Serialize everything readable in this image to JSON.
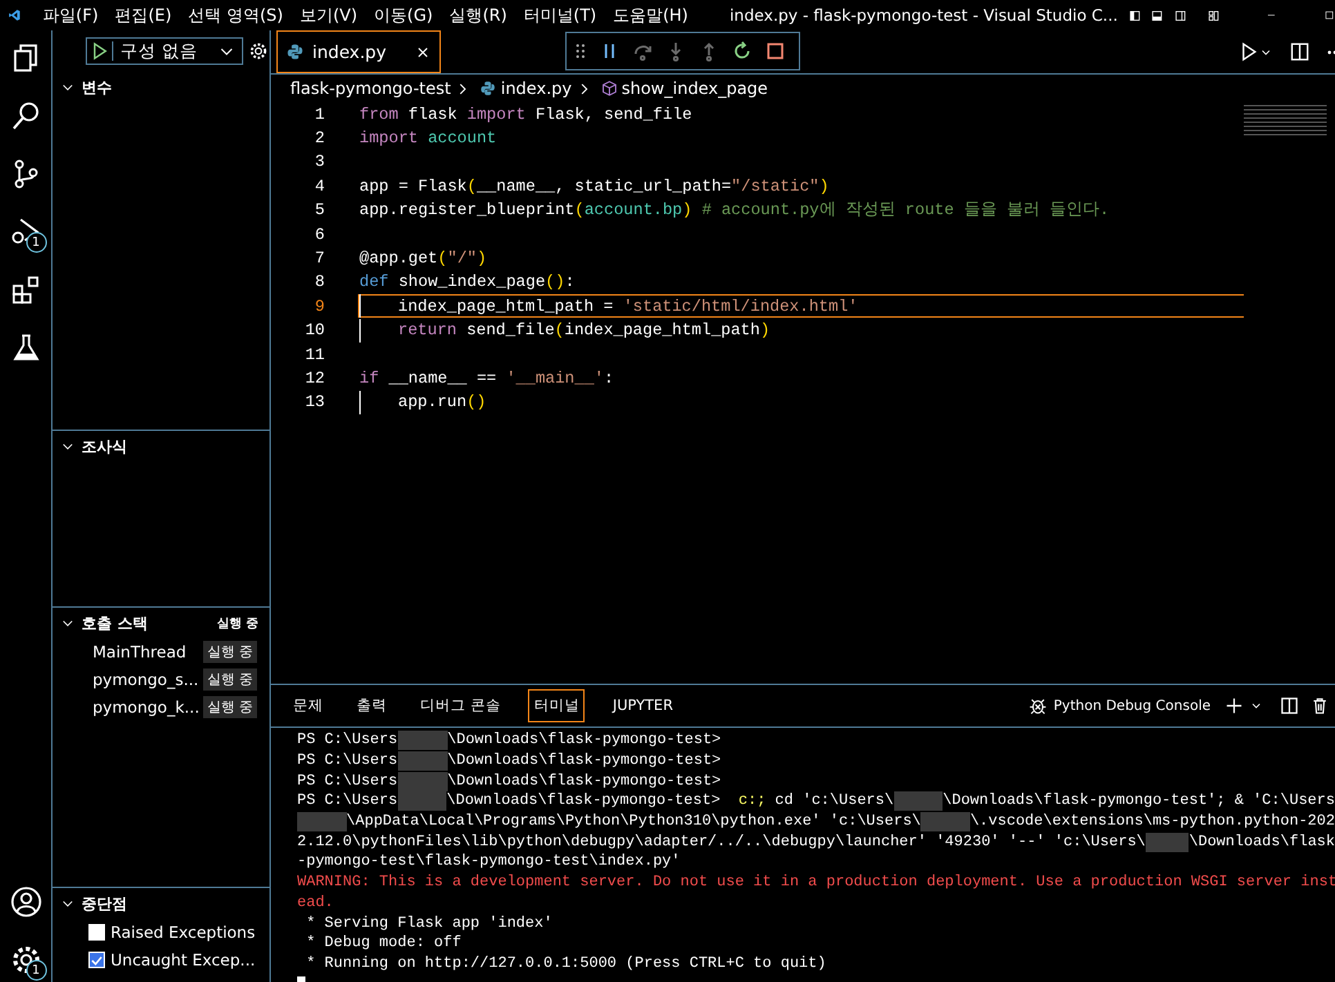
{
  "title_bar": {
    "menus": [
      "파일(F)",
      "편집(E)",
      "선택 영역(S)",
      "보기(V)",
      "이동(G)",
      "실행(R)",
      "터미널(T)",
      "도움말(H)"
    ],
    "title": "index.py - flask-pymongo-test - Visual Studio C..."
  },
  "activity_bar": {
    "debug_badge": "1",
    "settings_badge": "1"
  },
  "sidebar": {
    "run_config": "구성 없음",
    "sections": [
      {
        "kind": "variables",
        "title": "변수",
        "expanded": true
      },
      {
        "kind": "watch",
        "title": "조사식",
        "expanded": true
      },
      {
        "kind": "call_stack",
        "title": "호출 스택",
        "status": "실행 중",
        "expanded": true,
        "threads": [
          {
            "name": "MainThread",
            "status": "실행 중"
          },
          {
            "name": "pymongo_s...",
            "status": "실행 중"
          },
          {
            "name": "pymongo_k...",
            "status": "실행 중"
          }
        ]
      },
      {
        "kind": "breakpoints",
        "title": "중단점",
        "expanded": true,
        "items": [
          {
            "label": "Raised Exceptions",
            "checked": false
          },
          {
            "label": "Uncaught Excep...",
            "checked": true
          }
        ]
      }
    ]
  },
  "debug_toolbar": [
    {
      "kind": "pause",
      "disabled": false
    },
    {
      "kind": "step-over",
      "disabled": true
    },
    {
      "kind": "step-into",
      "disabled": true
    },
    {
      "kind": "step-out",
      "disabled": true
    },
    {
      "kind": "restart",
      "disabled": false
    },
    {
      "kind": "stop",
      "disabled": false
    }
  ],
  "editor": {
    "tabs": [
      {
        "label": "index.py",
        "selected": true
      }
    ],
    "breadcrumbs": [
      "flask-pymongo-test",
      "index.py",
      "show_index_page"
    ],
    "lines": [
      {
        "number": "1",
        "current": false,
        "indent": false,
        "tokens": [
          {
            "kind": "kw",
            "text": "from"
          },
          {
            "kind": "plain",
            "text": " flask "
          },
          {
            "kind": "kw",
            "text": "import"
          },
          {
            "kind": "plain",
            "text": " Flask, send_file"
          }
        ]
      },
      {
        "number": "2",
        "current": false,
        "indent": false,
        "tokens": [
          {
            "kind": "kw",
            "text": "import"
          },
          {
            "kind": "mod",
            "text": " account"
          }
        ]
      },
      {
        "number": "3",
        "current": false,
        "indent": false
      },
      {
        "number": "4",
        "current": false,
        "indent": false,
        "tokens": [
          {
            "kind": "plain",
            "text": "app = Flask"
          },
          {
            "kind": "paren",
            "text": "("
          },
          {
            "kind": "plain",
            "text": "__name__, static_url_path="
          },
          {
            "kind": "str",
            "text": "\"/static\""
          },
          {
            "kind": "paren",
            "text": ")"
          }
        ]
      },
      {
        "number": "5",
        "current": false,
        "indent": false,
        "tokens": [
          {
            "kind": "plain",
            "text": "app.register_blueprint"
          },
          {
            "kind": "paren",
            "text": "("
          },
          {
            "kind": "mod",
            "text": "account.bp"
          },
          {
            "kind": "paren",
            "text": ")"
          },
          {
            "kind": "comment",
            "text": " # account.py에 작성된 route 들을 불러 들인다."
          }
        ]
      },
      {
        "number": "6",
        "current": false,
        "indent": false
      },
      {
        "number": "7",
        "current": false,
        "indent": false,
        "tokens": [
          {
            "kind": "plain",
            "text": "@app.get"
          },
          {
            "kind": "paren",
            "text": "("
          },
          {
            "kind": "str",
            "text": "\"/\""
          },
          {
            "kind": "paren",
            "text": ")"
          }
        ]
      },
      {
        "number": "8",
        "current": false,
        "indent": false,
        "tokens": [
          {
            "kind": "def",
            "text": "def"
          },
          {
            "kind": "plain",
            "text": " show_index_page"
          },
          {
            "kind": "paren",
            "text": "()"
          },
          {
            "kind": "plain",
            "text": ":"
          }
        ]
      },
      {
        "number": "9",
        "current": true,
        "indent": true,
        "tokens": [
          {
            "kind": "plain",
            "text": "index_page_html_path = "
          },
          {
            "kind": "str",
            "text": "'static/html/index.html'"
          }
        ]
      },
      {
        "number": "10",
        "current": false,
        "indent": true,
        "tokens": [
          {
            "kind": "kw",
            "text": "return"
          },
          {
            "kind": "plain",
            "text": " send_file"
          },
          {
            "kind": "paren",
            "text": "("
          },
          {
            "kind": "plain",
            "text": "index_page_html_path"
          },
          {
            "kind": "paren",
            "text": ")"
          }
        ]
      },
      {
        "number": "11",
        "current": false,
        "indent": false
      },
      {
        "number": "12",
        "current": false,
        "indent": false,
        "tokens": [
          {
            "kind": "kw",
            "text": "if"
          },
          {
            "kind": "plain",
            "text": " __name__ == "
          },
          {
            "kind": "str",
            "text": "'__main__'"
          },
          {
            "kind": "plain",
            "text": ":"
          }
        ]
      },
      {
        "number": "13",
        "current": false,
        "indent": true,
        "tokens": [
          {
            "kind": "plain",
            "text": "app.run"
          },
          {
            "kind": "paren",
            "text": "()"
          }
        ]
      }
    ]
  },
  "panel": {
    "tabs": [
      {
        "label": "문제",
        "selected": false
      },
      {
        "label": "출력",
        "selected": false
      },
      {
        "label": "디버그 콘솔",
        "selected": false
      },
      {
        "label": "터미널",
        "selected": true
      },
      {
        "label": "JUPYTER",
        "selected": false
      }
    ],
    "terminal_name": "Python Debug Console",
    "terminal_lines": [
      [
        {
          "kind": "plain",
          "text": "PS C:\\Users"
        },
        {
          "kind": "redacted"
        },
        {
          "kind": "plain",
          "text": "\\Downloads\\flask-pymongo-test>"
        }
      ],
      [
        {
          "kind": "plain",
          "text": "PS C:\\Users"
        },
        {
          "kind": "redacted"
        },
        {
          "kind": "plain",
          "text": "\\Downloads\\flask-pymongo-test>"
        }
      ],
      [
        {
          "kind": "plain",
          "text": "PS C:\\Users"
        },
        {
          "kind": "redacted"
        },
        {
          "kind": "plain",
          "text": "\\Downloads\\flask-pymongo-test>"
        }
      ],
      [
        {
          "kind": "plain",
          "text": "PS C:\\Users"
        },
        {
          "kind": "redacted"
        },
        {
          "kind": "plain",
          "text": "\\Downloads\\flask-pymongo-test>  "
        },
        {
          "kind": "command",
          "text": "c:;"
        },
        {
          "kind": "plain",
          "text": " cd 'c:\\Users\\"
        },
        {
          "kind": "redacted"
        },
        {
          "kind": "plain",
          "text": "\\Downloads\\flask-pymongo-test'; & 'C:\\Users"
        }
      ],
      [
        {
          "kind": "redacted"
        },
        {
          "kind": "plain",
          "text": "\\AppData\\Local\\Programs\\Python\\Python310\\python.exe' 'c:\\Users\\"
        },
        {
          "kind": "redacted"
        },
        {
          "kind": "plain",
          "text": "\\.vscode\\extensions\\ms-python.python-202"
        }
      ],
      [
        {
          "kind": "plain",
          "text": "2.12.0\\pythonFiles\\lib\\python\\debugpy\\adapter/../..\\debugpy\\launcher' '49230' '--' 'c:\\Users\\"
        },
        {
          "kind": "redacted"
        },
        {
          "kind": "plain",
          "text": "\\Downloads\\flask"
        }
      ],
      [
        {
          "kind": "plain",
          "text": "-pymongo-test\\flask-pymongo-test\\index.py'"
        }
      ],
      [
        {
          "kind": "error",
          "text": "WARNING: This is a development server. Do not use it in a production deployment. Use a production WSGI server inst"
        }
      ],
      [
        {
          "kind": "error",
          "text": "ead."
        }
      ],
      [
        {
          "kind": "plain",
          "text": " * Serving Flask app 'index'"
        }
      ],
      [
        {
          "kind": "plain",
          "text": " * Debug mode: off"
        }
      ],
      [
        {
          "kind": "plain",
          "text": " * Running on http://127.0.0.1:5000 (Press CTRL+C to quit)"
        }
      ]
    ]
  }
}
